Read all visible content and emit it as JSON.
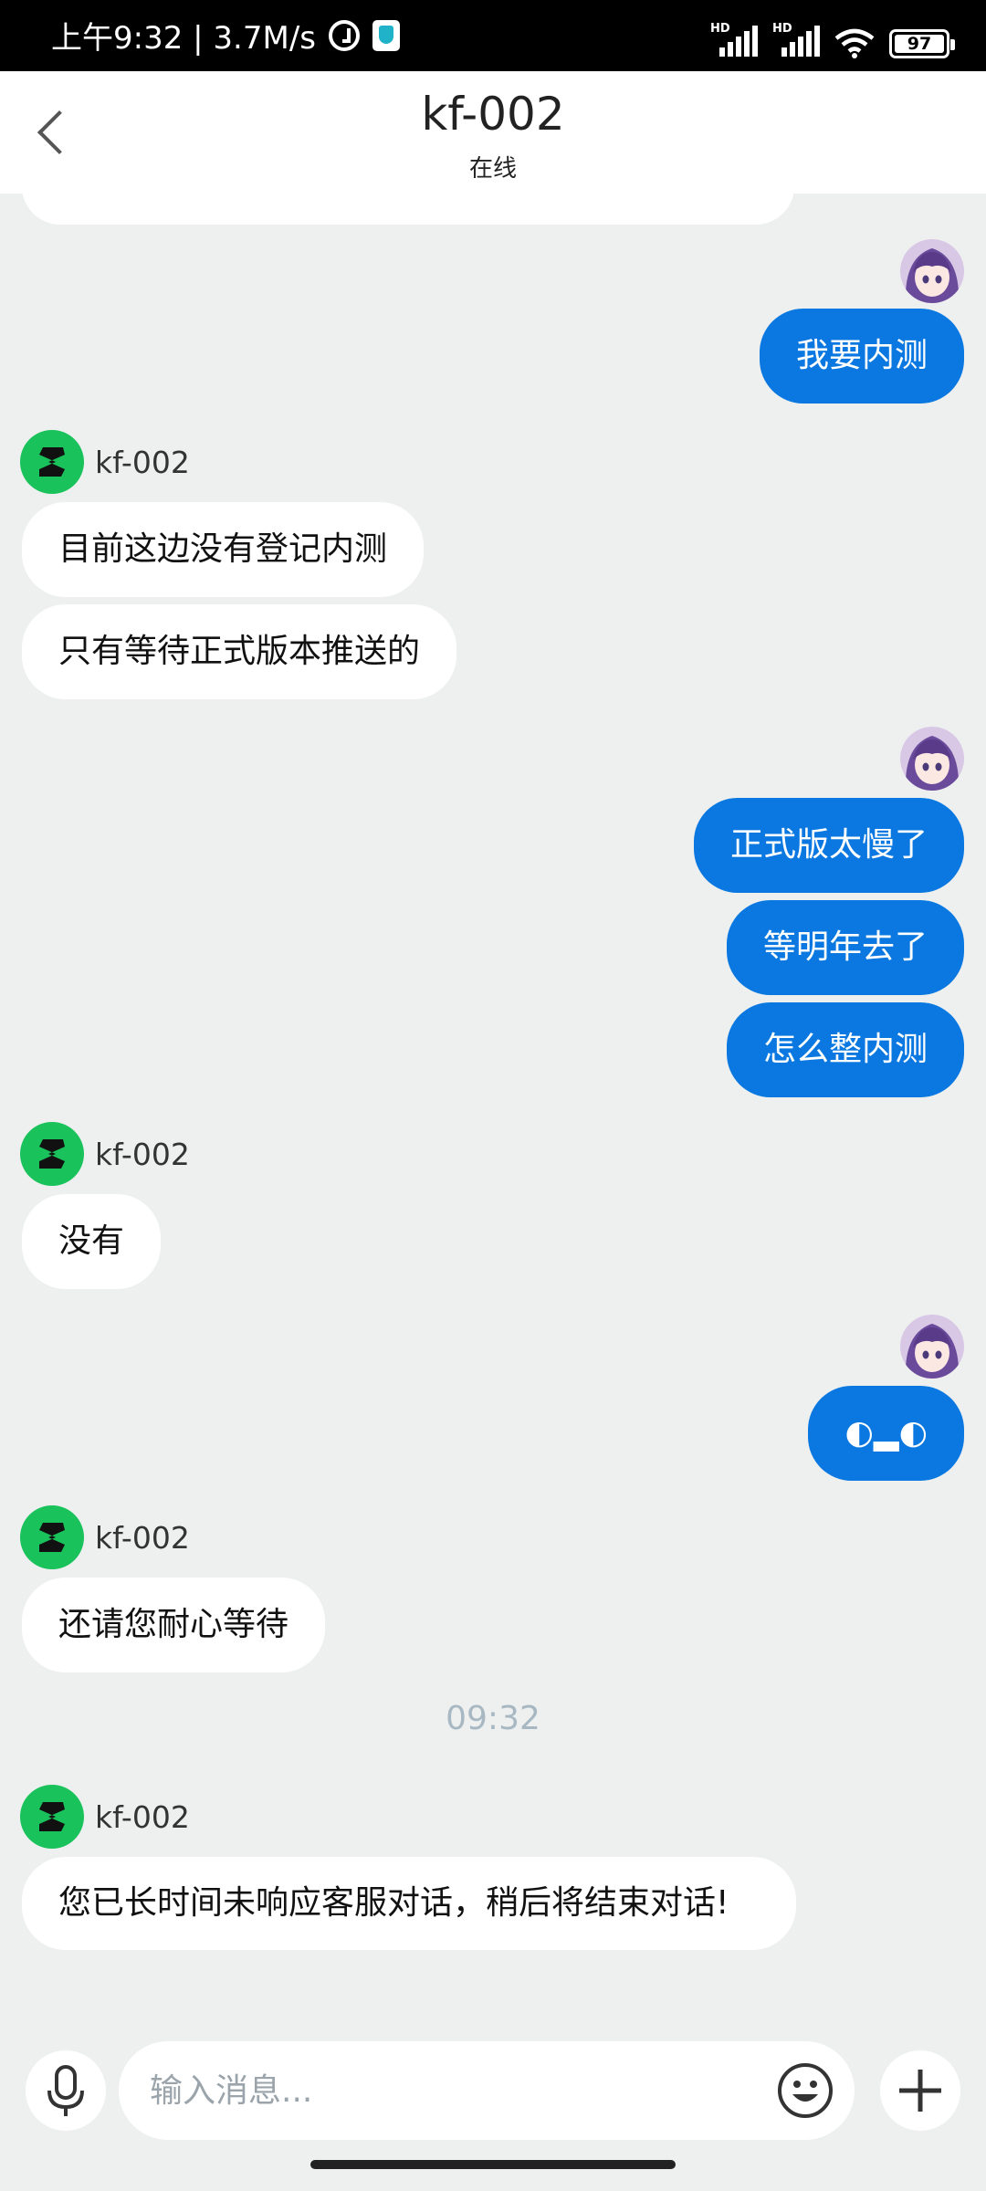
{
  "status_bar": {
    "time_speed": "上午9:32 | 3.7M/s",
    "battery": "97",
    "signal1": "HD",
    "signal2": "HD",
    "icons": [
      "alarm-icon",
      "shield-icon",
      "signal-icon",
      "wifi-icon",
      "battery-icon"
    ]
  },
  "header": {
    "title": "kf-002",
    "status": "在线",
    "back_icon": "chevron-left-icon"
  },
  "agent": {
    "name": "kf-002"
  },
  "messages": [
    {
      "from": "me",
      "text": "我要内测"
    },
    {
      "from": "agent",
      "text": "目前这边没有登记内测"
    },
    {
      "from": "agent",
      "text": "只有等待正式版本推送的"
    },
    {
      "from": "me",
      "text": "正式版太慢了"
    },
    {
      "from": "me",
      "text": "等明年去了"
    },
    {
      "from": "me",
      "text": "怎么整内测"
    },
    {
      "from": "agent",
      "text": "没有"
    },
    {
      "from": "me",
      "text": "◐▂◐"
    },
    {
      "from": "agent",
      "text": "还请您耐心等待"
    },
    {
      "from": "agent",
      "text": "您已长时间未响应客服对话，稍后将结束对话!"
    }
  ],
  "timestamp": "09:32",
  "input": {
    "placeholder": "输入消息...",
    "value": ""
  },
  "colors": {
    "outgoing_bubble": "#0a78e0",
    "agent_logo": "#19c25a",
    "background": "#eef0f0"
  }
}
